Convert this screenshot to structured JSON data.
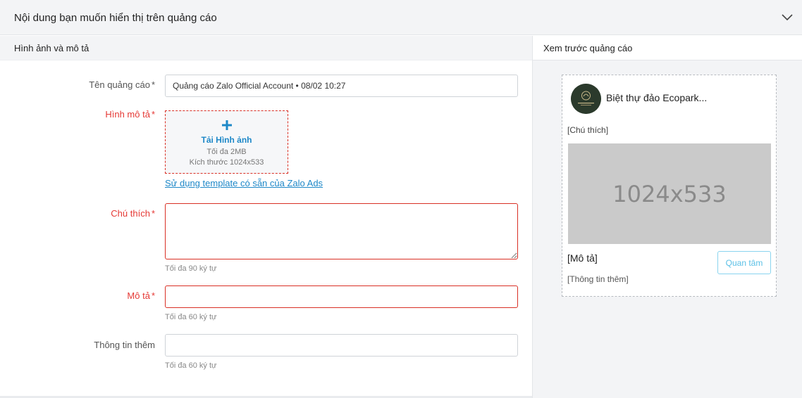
{
  "section": {
    "title": "Nội dung bạn muốn hiển thị trên quảng cáo",
    "collapse_icon": "chevron-down-icon"
  },
  "left": {
    "title": "Hình ảnh và mô tả"
  },
  "form": {
    "ad_name": {
      "label": "Tên quảng cáo",
      "required_mark": "*",
      "value": "Quảng cáo Zalo Official Account • 08/02 10:27"
    },
    "image": {
      "label": "Hình mô tả",
      "required_mark": "*",
      "upload_icon": "plus-icon",
      "upload_title": "Tải Hình ảnh",
      "upload_max": "Tối đa 2MB",
      "upload_size": "Kích thước 1024x533",
      "template_link": "Sử dụng template có sẵn của Zalo Ads"
    },
    "caption": {
      "label": "Chú thích",
      "required_mark": "*",
      "value": "",
      "hint": "Tối đa 90 ký tự"
    },
    "description": {
      "label": "Mô tả",
      "required_mark": "*",
      "value": "",
      "hint": "Tối đa 60 ký tự"
    },
    "more_info": {
      "label": "Thông tin thêm",
      "value": "",
      "hint": "Tối đa 60 ký tự"
    }
  },
  "preview": {
    "title": "Xem trước quảng cáo",
    "name": "Biệt thự đảo Ecopark...",
    "caption": "[Chú thích]",
    "image_size": "1024x533",
    "description": "[Mô tả]",
    "more_info": "[Thông tin thêm]",
    "follow_button": "Quan tâm"
  },
  "colors": {
    "accent": "#1e88c8",
    "error": "#d93025",
    "follow": "#5bc0e6"
  }
}
